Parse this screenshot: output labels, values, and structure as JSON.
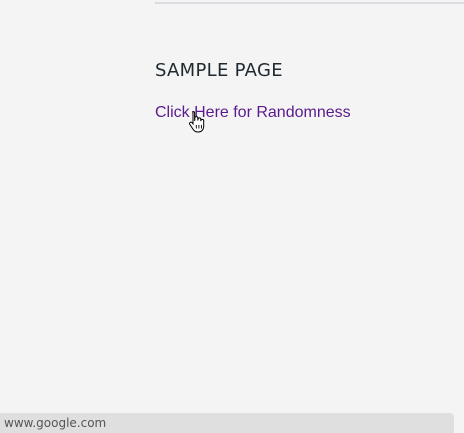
{
  "page": {
    "title": "SAMPLE PAGE",
    "link_label": "Click Here for Randomness"
  },
  "status_bar": {
    "url": "www.google.com"
  },
  "colors": {
    "link": "#5a1a8c",
    "title": "#1f2a30",
    "background": "#f4f4f4"
  }
}
